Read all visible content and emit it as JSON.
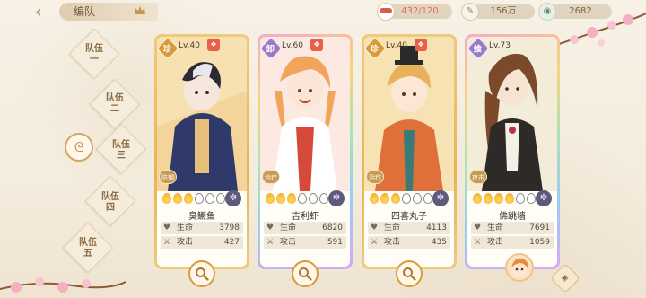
{
  "header": {
    "title": "编队",
    "resources": {
      "stamina": {
        "current": "432",
        "max": "120"
      },
      "coins": "156万",
      "gems": "2682"
    }
  },
  "team_tabs": [
    {
      "line1": "队伍",
      "line2": "一"
    },
    {
      "line1": "队伍",
      "line2": "二"
    },
    {
      "line1": "队伍",
      "line2": "三"
    },
    {
      "line1": "队伍",
      "line2": "四"
    },
    {
      "line1": "队伍",
      "line2": "五"
    }
  ],
  "heroes": [
    {
      "rarity": "珍",
      "level": "Lv.40",
      "role": "防御",
      "name": "臭鳜鱼",
      "hp_label": "生命",
      "hp": "3798",
      "atk_label": "攻击",
      "atk": "427",
      "awake_on": 3,
      "awake_total": 6
    },
    {
      "rarity": "卸",
      "level": "Lv.60",
      "role": "治疗",
      "name": "吉利虾",
      "hp_label": "生命",
      "hp": "6820",
      "atk_label": "攻击",
      "atk": "591",
      "awake_on": 3,
      "awake_total": 6
    },
    {
      "rarity": "珍",
      "level": "Lv.40",
      "role": "治疗",
      "name": "四喜丸子",
      "hp_label": "生命",
      "hp": "4113",
      "atk_label": "攻击",
      "atk": "435",
      "awake_on": 3,
      "awake_total": 6
    },
    {
      "rarity": "飨",
      "level": "Lv.73",
      "role": "攻击",
      "name": "佛跳墙",
      "hp_label": "生命",
      "hp": "7691",
      "atk_label": "攻击",
      "atk": "1059",
      "awake_on": 4,
      "awake_total": 6
    }
  ],
  "colors": {
    "gold_frame": "#e8b454",
    "accent_brown": "#8a6a40",
    "background": "#f4ecdd"
  },
  "icons": {
    "back": "back-arrow-icon",
    "crown": "crown-icon",
    "stamina": "stamina-icon",
    "coins": "coin-icon",
    "gems": "gem-icon",
    "hp": "heart-icon",
    "atk": "sword-icon",
    "magnify": "magnify-icon"
  }
}
